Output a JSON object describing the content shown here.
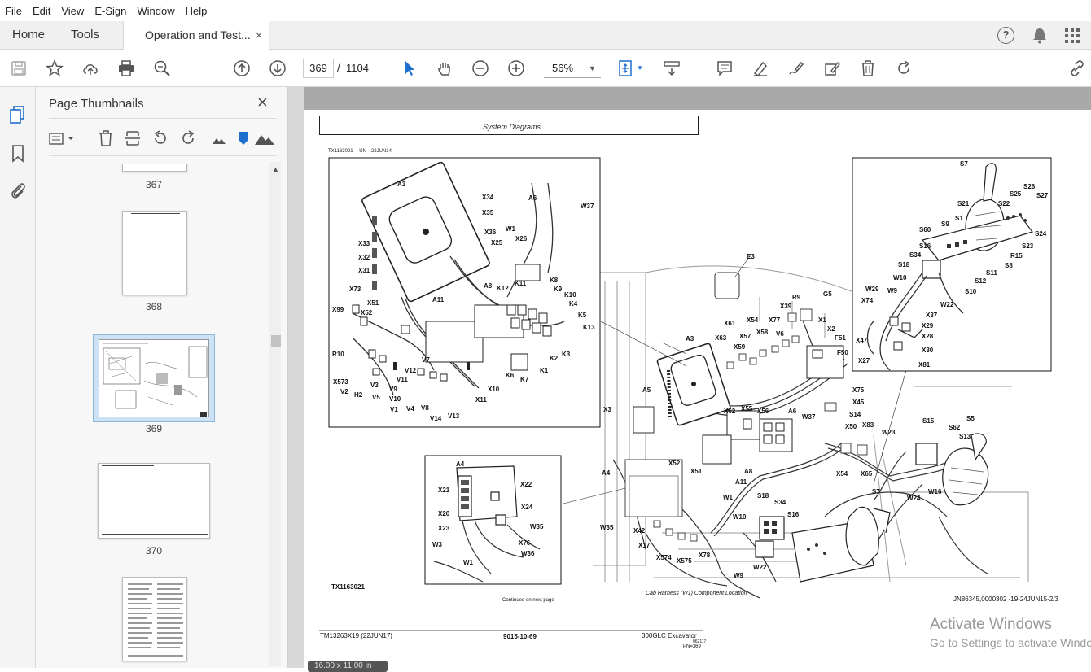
{
  "menu": [
    "File",
    "Edit",
    "View",
    "E-Sign",
    "Window",
    "Help"
  ],
  "tabs": {
    "home": "Home",
    "tools": "Tools",
    "document": "Operation and Test...",
    "close": "×"
  },
  "toolbar": {
    "page_current": "369",
    "page_sep": "/",
    "page_total": "1104",
    "zoom": "56%"
  },
  "panel": {
    "title": "Page Thumbnails",
    "close": "×"
  },
  "thumbnails": [
    "367",
    "368",
    "369",
    "370"
  ],
  "page": {
    "header": "System Diagrams",
    "figure_id_top": "TX1163021 —UN—22JUN14",
    "figure_id": "TX1163021",
    "continued": "Continued on next page",
    "caption": "Cab Harness (W1) Component Location",
    "ref": "JN86345,0000302 -19-24JUN15-2/3",
    "footer_left": "TM13263X19 (22JUN17)",
    "footer_center": "9015-10-69",
    "footer_right": "300GLC Excavator",
    "footer_right2": "062117",
    "footer_pn": "PN=369",
    "page_size": "16.00 x 11.00 in"
  },
  "labels": {
    "inset1": [
      "A3",
      "X34",
      "X35",
      "A6",
      "W37",
      "W1",
      "X36",
      "X26",
      "X25",
      "X33",
      "X32",
      "X31",
      "K11",
      "K8",
      "X73",
      "K12",
      "K9",
      "A8",
      "A11",
      "X99",
      "X51",
      "X52",
      "K10",
      "K4",
      "K5",
      "K13",
      "R10",
      "V7",
      "K3",
      "K2",
      "K1",
      "K6",
      "K7",
      "V12",
      "V11",
      "X10",
      "X11",
      "X573",
      "V3",
      "V9",
      "V10",
      "V2",
      "H2",
      "V5",
      "V4",
      "V8",
      "V1",
      "V14",
      "V13"
    ],
    "inset2": [
      "A4",
      "X21",
      "X22",
      "X24",
      "X20",
      "W35",
      "X23",
      "X76",
      "W3",
      "W36",
      "W1"
    ],
    "inset3": [
      "S7",
      "S26",
      "S25",
      "S27",
      "S22",
      "S21",
      "S1",
      "S24",
      "S9",
      "S60",
      "S23",
      "S16",
      "R15",
      "S34",
      "S8",
      "S18",
      "S11",
      "W10",
      "S12",
      "W29",
      "S10",
      "W9",
      "W22",
      "X74",
      "X37",
      "X29",
      "X28",
      "X47",
      "X30",
      "X27",
      "X81"
    ],
    "main": [
      "E3",
      "R9",
      "G5",
      "X39",
      "X77",
      "X54",
      "X1",
      "X61",
      "V6",
      "X58",
      "X63",
      "X2",
      "F51",
      "X57",
      "A3",
      "X59",
      "F50",
      "A5",
      "X75",
      "X45",
      "X3",
      "X55",
      "X62",
      "X56",
      "A6",
      "W37",
      "S14",
      "X50",
      "X83",
      "W23",
      "S15",
      "S62",
      "S13",
      "S5",
      "X52",
      "X51",
      "A8",
      "A11",
      "X54",
      "X65",
      "A4",
      "W1",
      "W16",
      "S7",
      "W24",
      "S18",
      "S34",
      "W10",
      "S16",
      "W35",
      "X42",
      "X17",
      "X574",
      "X575",
      "X78",
      "W22",
      "W9"
    ]
  },
  "watermark": {
    "line1": "Activate Windows",
    "line2": "Go to Settings to activate Windows."
  }
}
